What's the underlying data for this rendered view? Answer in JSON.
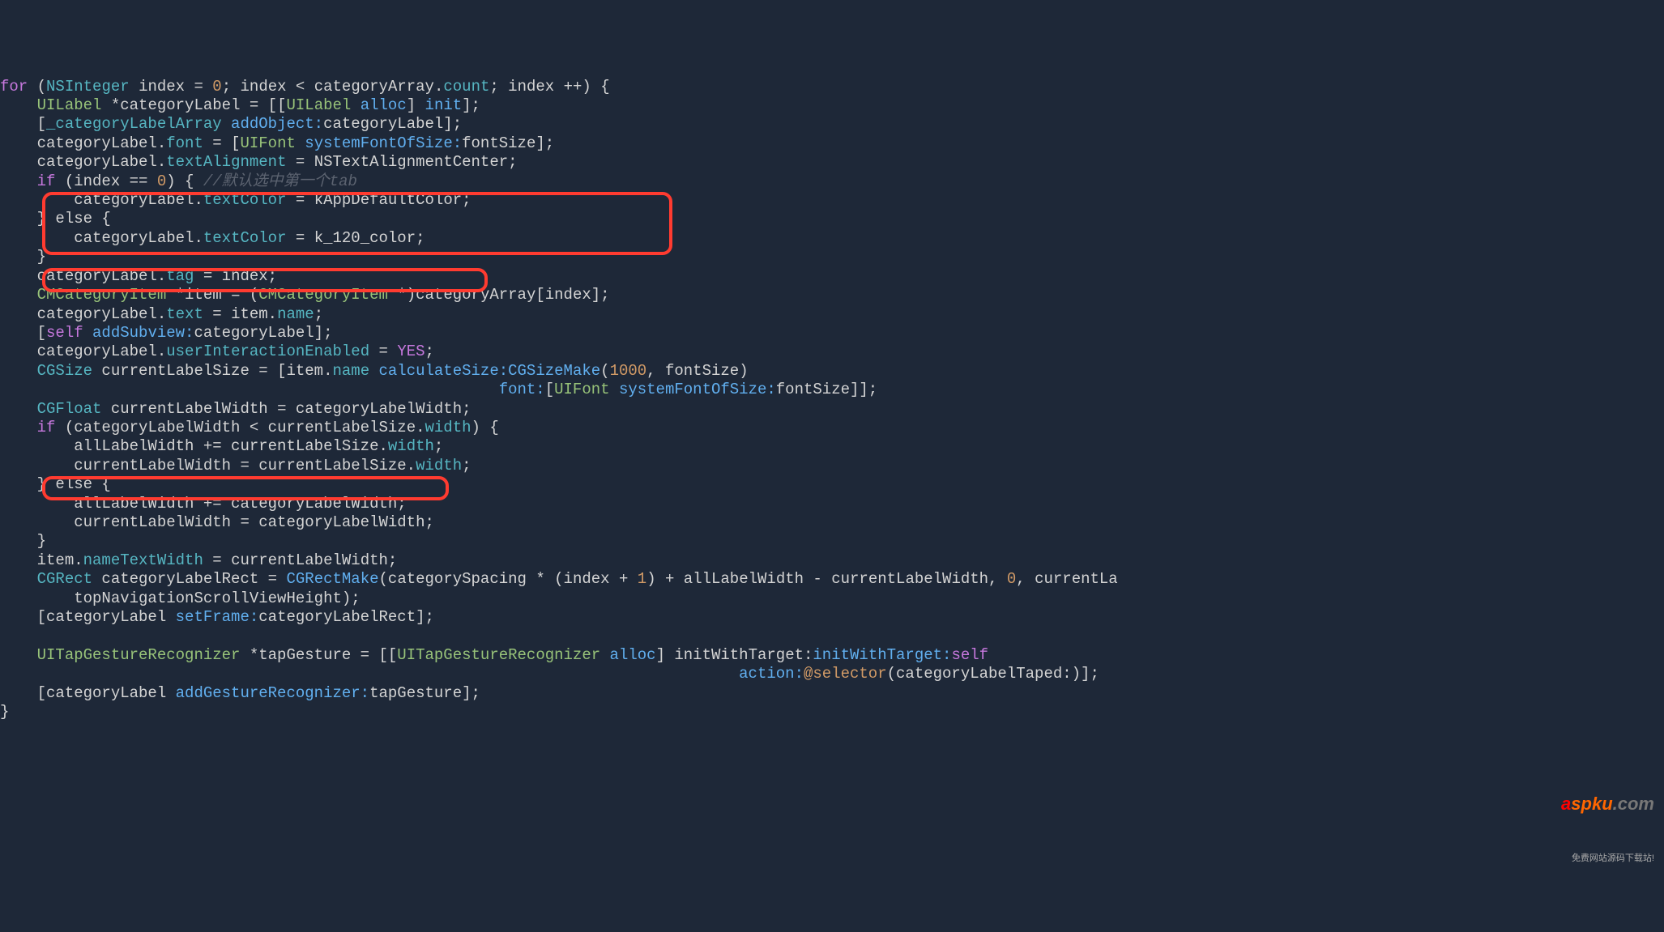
{
  "code": {
    "l1": {
      "for": "for",
      "type": "NSInteger",
      "idx": "index",
      "zero": "0",
      "cond": "index < categoryArray.",
      "count": "count",
      "inc": "; index ++) {"
    },
    "l2": {
      "cls": "UILabel",
      "var": " *categoryLabel = [[",
      "alloc": "alloc",
      "init": " init",
      "end": "];"
    },
    "l3": {
      "arr": "_categoryLabelArray",
      "msg": " addObject:",
      "arg": "categoryLabel];"
    },
    "l4": {
      "obj": "categoryLabel.",
      "prop": "font",
      "eq": " = [",
      "cls": "UIFont",
      "msg": " systemFontOfSize:",
      "arg": "fontSize];"
    },
    "l5": {
      "obj": "categoryLabel.",
      "prop": "textAlignment",
      "eq": " = NSTextAlignmentCenter;"
    },
    "l6": {
      "if": "if",
      "cond": " (index == ",
      "zero": "0",
      "brace": ") { ",
      "cmt": "//默认选中第一个tab"
    },
    "l7": {
      "obj": "categoryLabel.",
      "prop": "textColor",
      "eq": " = kAppDefaultColor;"
    },
    "l8": {
      "else": "} else {"
    },
    "l9": {
      "obj": "categoryLabel.",
      "prop": "textColor",
      "eq": " = k_120_color;"
    },
    "l10": "}",
    "l11": {
      "obj": "categoryLabel.",
      "prop": "tag",
      "eq": " = index;"
    },
    "l12": {
      "cls": "CMCategoryItem",
      "var": " *item = (",
      "cls2": "CMCategoryItem",
      "rest": " *)categoryArray[index];"
    },
    "l13": {
      "obj": "categoryLabel.",
      "prop": "text",
      "eq": " = item.",
      "prop2": "name",
      "semi": ";"
    },
    "l14": {
      "self": "self",
      "msg": " addSubview:",
      "arg": "categoryLabel];"
    },
    "l15": {
      "obj": "categoryLabel.",
      "prop": "userInteractionEnabled",
      "eq": " = ",
      "yes": "YES",
      "semi": ";"
    },
    "l16": {
      "type": "CGSize",
      "rest": " currentLabelSize = [item.",
      "prop": "name",
      "msg": " calculateSize:",
      "func": "CGSizeMake",
      "open": "(",
      "n1": "1000",
      "comma": ", fontSize)"
    },
    "l17": {
      "msg": "font:",
      "open": "[",
      "cls": "UIFont",
      "msg2": " systemFontOfSize:",
      "arg": "fontSize]];"
    },
    "l18": {
      "type": "CGFloat",
      "rest": " currentLabelWidth = categoryLabelWidth;"
    },
    "l19": {
      "if": "if",
      "cond": " (categoryLabelWidth < currentLabelSize.",
      "prop": "width",
      "brace": ") {"
    },
    "l20": {
      "txt": "allLabelWidth += currentLabelSize.",
      "prop": "width",
      "semi": ";"
    },
    "l21": {
      "txt": "currentLabelWidth = currentLabelSize.",
      "prop": "width",
      "semi": ";"
    },
    "l22": {
      "else": "} else {"
    },
    "l23": "allLabelWidth += categoryLabelWidth;",
    "l24": "currentLabelWidth = categoryLabelWidth;",
    "l25": "}",
    "l26": {
      "obj": "item.",
      "prop": "nameTextWidth",
      "eq": " = currentLabelWidth;"
    },
    "l27": {
      "type": "CGRect",
      "rest": " categoryLabelRect = ",
      "func": "CGRectMake",
      "open": "(categorySpacing * (index + ",
      "one": "1",
      "mid": ") + allLabelWidth - currentLabelWidth, ",
      "zero": "0",
      "tail": ", currentLa"
    },
    "l28": "topNavigationScrollViewHeight);",
    "l29": {
      "open": "[categoryLabel ",
      "msg": "setFrame:",
      "arg": "categoryLabelRect];"
    },
    "l30": {
      "cls": "UITapGestureRecognizer",
      "var": " *tapGesture = [[",
      "cls2": "UITapGestureRecognizer",
      "alloc": " alloc",
      "msg": "] initWithTarget:",
      "self": "self"
    },
    "l31": {
      "msg": "action:",
      "sel": "@selector",
      "open": "(categoryLabelTaped:)];"
    },
    "l32": {
      "open": "[categoryLabel ",
      "msg": "addGestureRecognizer:",
      "arg": "tapGesture];"
    },
    "l33": "}"
  },
  "watermark": {
    "brand_a": "a",
    "brand_b": "spku",
    "brand_c": ".com",
    "tagline": "免费网站源码下载站!"
  }
}
